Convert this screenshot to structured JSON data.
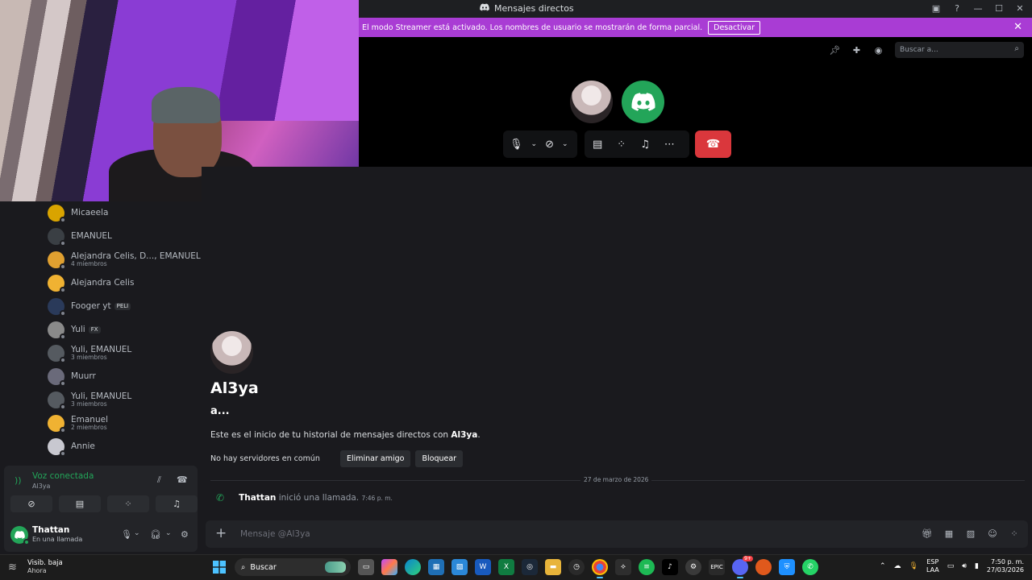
{
  "window": {
    "title": "Mensajes directos"
  },
  "banner": {
    "text": "El modo Streamer está activado. Los nombres de usuario se mostrarán de forma parcial.",
    "button": "Desactivar"
  },
  "call": {
    "search_placeholder": "Buscar a..."
  },
  "dm_list": [
    {
      "name": "Micaeela",
      "sub": "",
      "badge": "",
      "color": "#d9a400"
    },
    {
      "name": "EMANUEL",
      "sub": "",
      "badge": "",
      "color": "#3a3f44"
    },
    {
      "name": "Alejandra Celis, D..., EMANUEL",
      "sub": "4 miembros",
      "badge": "",
      "color": "#e0a030"
    },
    {
      "name": "Alejandra Celis",
      "sub": "",
      "badge": "",
      "color": "#f0b232"
    },
    {
      "name": "Fooger yt",
      "sub": "",
      "badge": "PELI",
      "color": "#2a3a5a"
    },
    {
      "name": "Yuli",
      "sub": "",
      "badge": "FX",
      "color": "#8a8a8a"
    },
    {
      "name": "Yuli, EMANUEL",
      "sub": "3 miembros",
      "badge": "",
      "color": "#555a60"
    },
    {
      "name": "Muurr",
      "sub": "",
      "badge": "",
      "color": "#6a6a7a"
    },
    {
      "name": "Yuli, EMANUEL",
      "sub": "3 miembros",
      "badge": "",
      "color": "#555a60"
    },
    {
      "name": "Emanuel",
      "sub": "2 miembros",
      "badge": "",
      "color": "#f0b232"
    },
    {
      "name": "Annie",
      "sub": "",
      "badge": "",
      "color": "#c8c8d0"
    }
  ],
  "voice": {
    "status": "Voz conectada",
    "channel": "Al3ya"
  },
  "user": {
    "name": "Thattan",
    "status": "En una llamada"
  },
  "chat": {
    "intro_name": "Al3ya",
    "intro_handle": "a...",
    "intro_text_prefix": "Este es el inicio de tu historial de mensajes directos con ",
    "intro_text_name": "Al3ya",
    "intro_text_suffix": ".",
    "no_servers": "No hay servidores en común",
    "remove_friend": "Eliminar amigo",
    "block": "Bloquear",
    "date_divider": "27 de marzo de 2026",
    "call_user": "Thattan",
    "call_text": "inició una llamada.",
    "call_time": "7:46 p. m.",
    "input_placeholder": "Mensaje @Al3ya"
  },
  "taskbar": {
    "weather_title": "Visib. baja",
    "weather_sub": "Ahora",
    "search": "Buscar",
    "lang_1": "ESP",
    "lang_2": "LAA",
    "time": "7:50 p. m.",
    "date": "27/03/2026",
    "notif_badge": "9+"
  }
}
